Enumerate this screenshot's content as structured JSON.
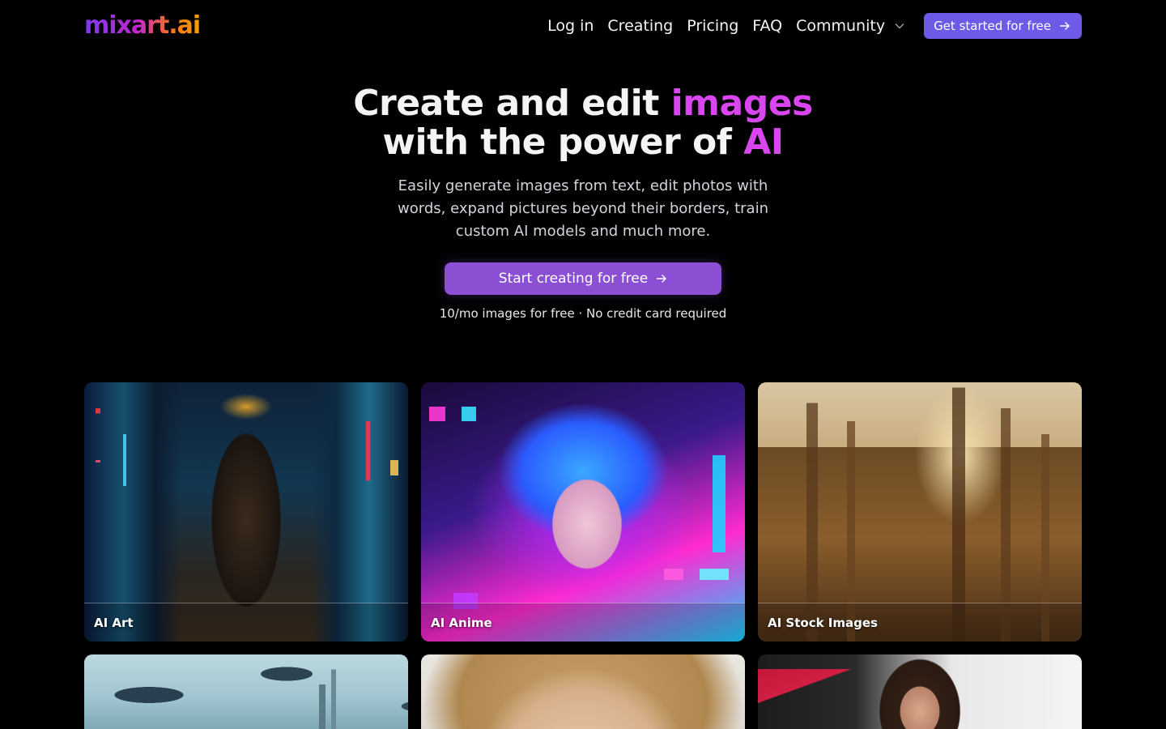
{
  "header": {
    "logo": "mixart.ai",
    "nav": [
      {
        "label": "Log in"
      },
      {
        "label": "Creating"
      },
      {
        "label": "Pricing"
      },
      {
        "label": "FAQ"
      }
    ],
    "community_label": "Community",
    "cta_label": "Get started for free"
  },
  "hero": {
    "title_line1_a": "Create and edit ",
    "title_line1_b": "images",
    "title_line2_a": "with the power of ",
    "title_line2_b": "AI",
    "subtitle": "Easily generate images from text, edit photos with words, expand pictures beyond their borders, train custom AI models and much more.",
    "cta_label": "Start creating for free",
    "note": "10/mo images for free · No credit card required"
  },
  "gallery": [
    {
      "label": "AI Art"
    },
    {
      "label": "AI Anime"
    },
    {
      "label": "AI Stock Images"
    },
    {
      "label": ""
    },
    {
      "label": ""
    },
    {
      "label": ""
    }
  ],
  "colors": {
    "accent": "#6d5ae6",
    "cta": "#8b4fd4",
    "highlight": "#d946ef",
    "background": "#000000"
  }
}
